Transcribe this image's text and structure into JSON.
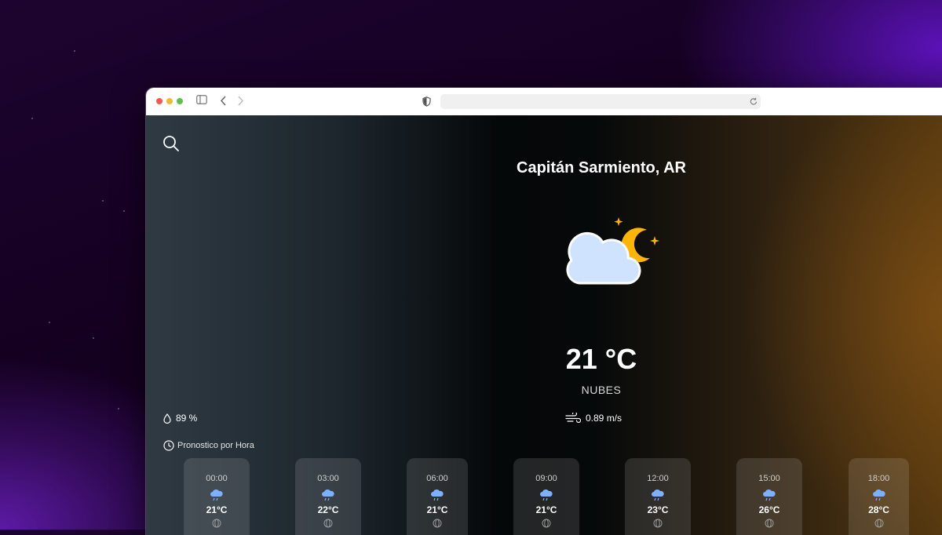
{
  "weather": {
    "city": "Capitán Sarmiento, AR",
    "temperature": "21 °C",
    "description": "NUBES",
    "humidity": "89 %",
    "wind": "0.89 m/s",
    "icon": "cloud-moon-icon"
  },
  "forecast": {
    "title": "Pronostico por Hora",
    "hours": [
      {
        "time": "00:00",
        "temp": "21°C",
        "icon": "cloud-rain-icon"
      },
      {
        "time": "03:00",
        "temp": "22°C",
        "icon": "cloud-rain-icon"
      },
      {
        "time": "06:00",
        "temp": "21°C",
        "icon": "cloud-rain-icon"
      },
      {
        "time": "09:00",
        "temp": "21°C",
        "icon": "cloud-rain-icon"
      },
      {
        "time": "12:00",
        "temp": "23°C",
        "icon": "cloud-rain-icon"
      },
      {
        "time": "15:00",
        "temp": "26°C",
        "icon": "cloud-rain-icon"
      },
      {
        "time": "18:00",
        "temp": "28°C",
        "icon": "cloud-rain-icon"
      }
    ]
  },
  "colors": {
    "cloud": "#cfe3ff",
    "moon": "#ffb40a",
    "rain": "#7fb0ff"
  }
}
